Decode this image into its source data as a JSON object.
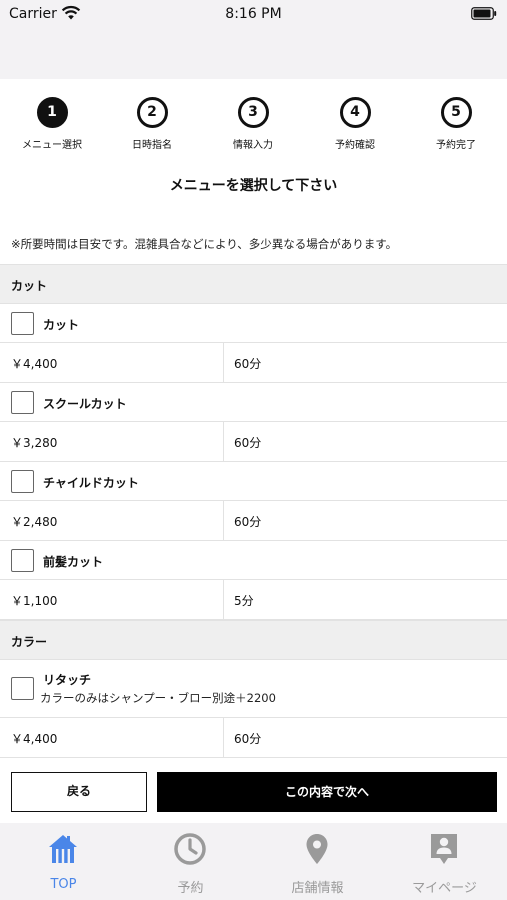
{
  "status": {
    "carrier": "Carrier",
    "time": "8:16 PM"
  },
  "steps": [
    {
      "number": "1",
      "label": "メニュー選択"
    },
    {
      "number": "2",
      "label": "日時指名"
    },
    {
      "number": "3",
      "label": "情報入力"
    },
    {
      "number": "4",
      "label": "予約確認"
    },
    {
      "number": "5",
      "label": "予約完了"
    }
  ],
  "current_step": 1,
  "heading": "メニューを選択して下さい",
  "notice": "※所要時間は目安です。混雑具合などにより、多少異なる場合があります。",
  "categories": [
    {
      "name": "カット"
    },
    {
      "name": "カラー"
    }
  ],
  "items": [
    {
      "name": "カット",
      "price": "￥4,400",
      "duration": "60分",
      "checked": false
    },
    {
      "name": "スクールカット",
      "price": "￥3,280",
      "duration": "60分",
      "checked": false
    },
    {
      "name": "チャイルドカット",
      "price": "￥2,480",
      "duration": "60分",
      "checked": false
    },
    {
      "name": "前髪カット",
      "price": "￥1,100",
      "duration": "5分",
      "checked": false
    },
    {
      "name": "リタッチ",
      "note": "カラーのみはシャンプー・ブロー別途＋2200",
      "price": "￥4,400",
      "duration": "60分",
      "checked": false
    }
  ],
  "buttons": {
    "back": "戻る",
    "next": "この内容で次へ"
  },
  "tabs": [
    {
      "label": "TOP",
      "icon": "home-icon",
      "active": true
    },
    {
      "label": "予約",
      "icon": "clock-icon",
      "active": false
    },
    {
      "label": "店舗情報",
      "icon": "map-pin-icon",
      "active": false
    },
    {
      "label": "マイページ",
      "icon": "profile-icon",
      "active": false
    }
  ],
  "colors": {
    "active_tab": "#4a86e8",
    "inactive_tab": "#9a9a9a",
    "primary_button": "#000000"
  }
}
